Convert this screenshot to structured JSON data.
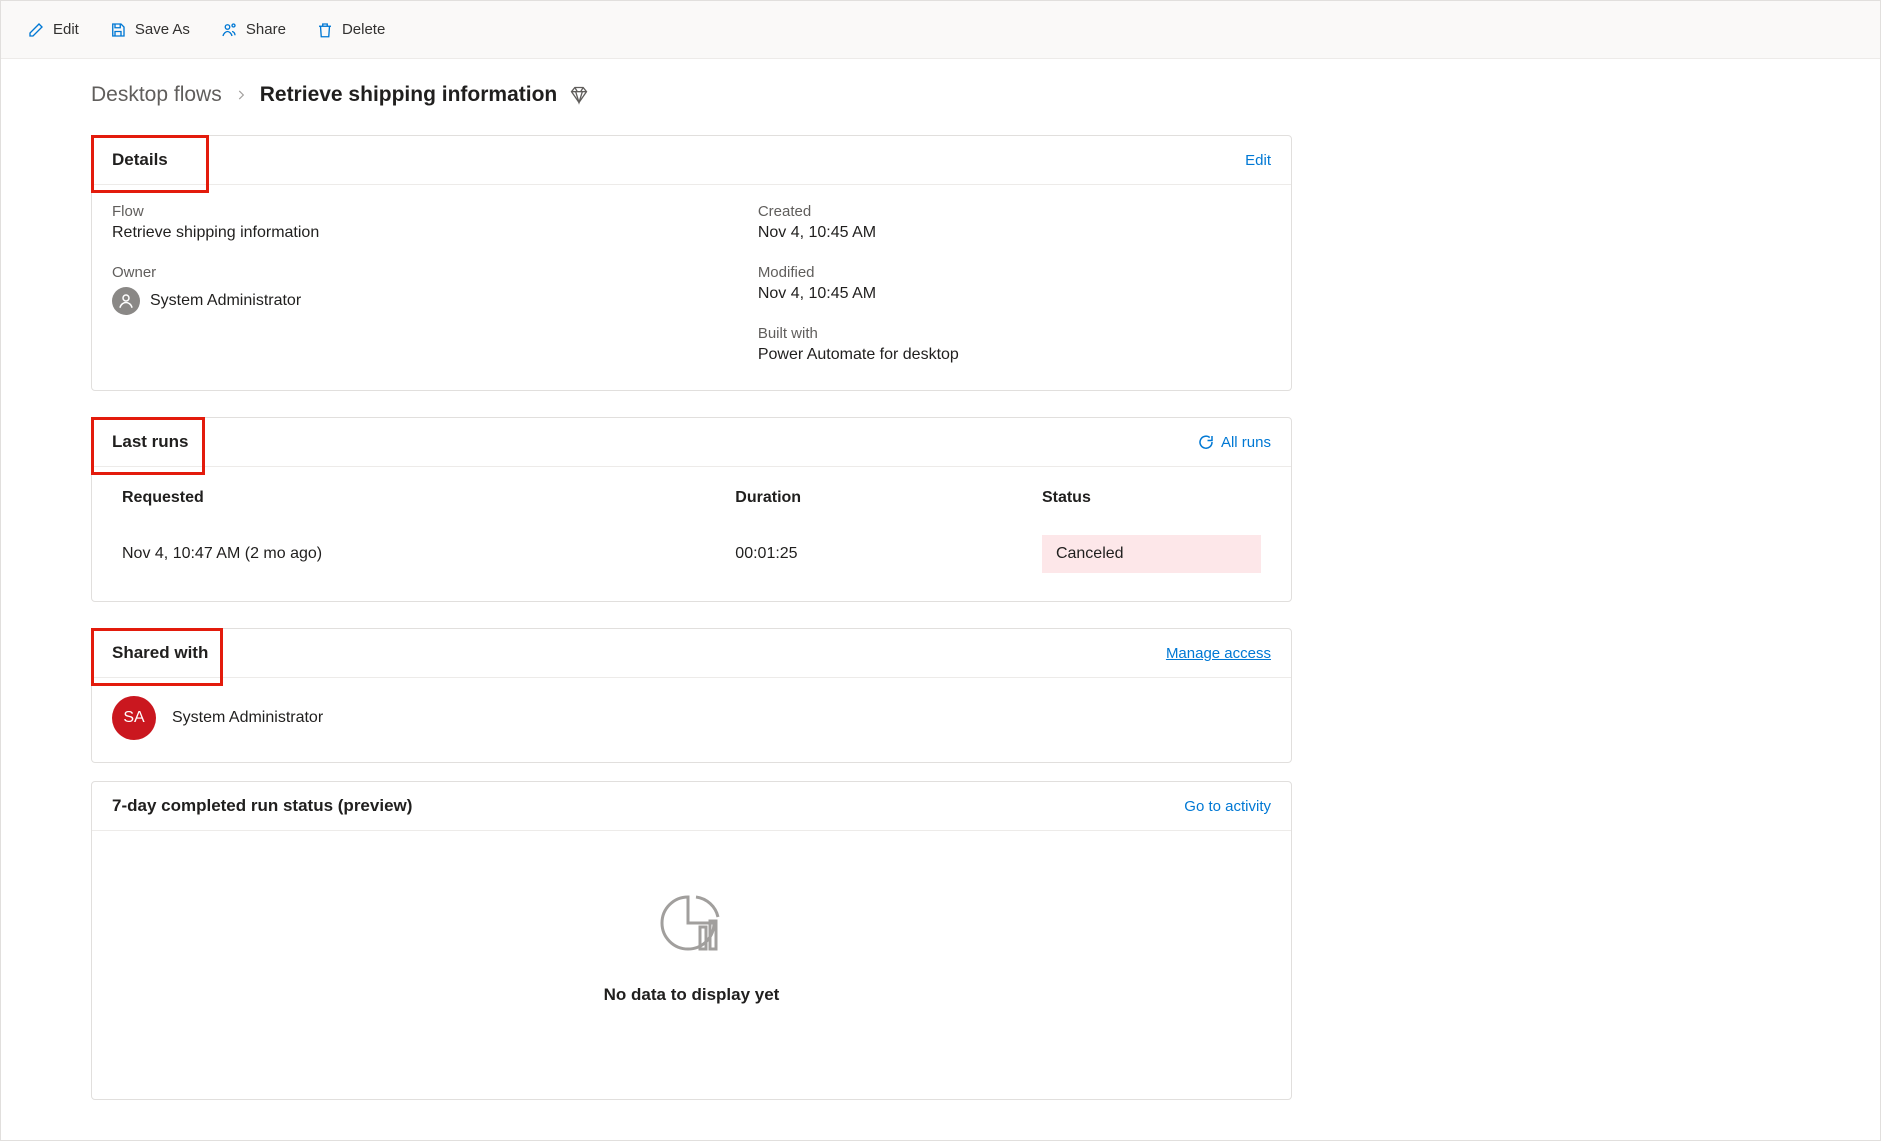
{
  "toolbar": {
    "edit": "Edit",
    "save_as": "Save As",
    "share": "Share",
    "delete": "Delete"
  },
  "breadcrumb": {
    "parent": "Desktop flows",
    "current": "Retrieve shipping information"
  },
  "details": {
    "title": "Details",
    "edit_link": "Edit",
    "flow_label": "Flow",
    "flow_value": "Retrieve shipping information",
    "owner_label": "Owner",
    "owner_value": "System Administrator",
    "created_label": "Created",
    "created_value": "Nov 4, 10:45 AM",
    "modified_label": "Modified",
    "modified_value": "Nov 4, 10:45 AM",
    "built_label": "Built with",
    "built_value": "Power Automate for desktop"
  },
  "last_runs": {
    "title": "Last runs",
    "all_runs": "All runs",
    "columns": {
      "requested": "Requested",
      "duration": "Duration",
      "status": "Status"
    },
    "row": {
      "requested": "Nov 4, 10:47 AM (2 mo ago)",
      "duration": "00:01:25",
      "status": "Canceled"
    }
  },
  "shared": {
    "title": "Shared with",
    "manage": "Manage access",
    "initials": "SA",
    "name": "System Administrator"
  },
  "run_status": {
    "title": "7-day completed run status (preview)",
    "activity": "Go to activity",
    "no_data": "No data to display yet"
  }
}
